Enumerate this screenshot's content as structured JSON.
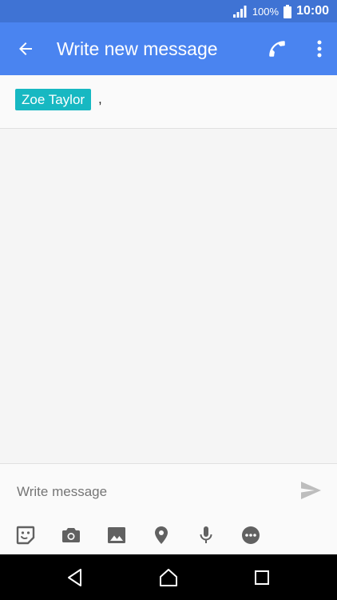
{
  "statusbar": {
    "battery_pct": "100%",
    "time": "10:00",
    "icons": [
      "signal-icon",
      "battery-icon"
    ]
  },
  "appbar": {
    "title": "Write new message",
    "icons": [
      "back-arrow-icon",
      "phone-icon",
      "more-vert-icon"
    ]
  },
  "recipients": [
    {
      "name": "Zoe Taylor"
    }
  ],
  "recipient_separator": ",",
  "compose": {
    "placeholder": "Write message",
    "value": "",
    "send_icon": "send-icon"
  },
  "toolbar": {
    "icons": [
      "sticker-icon",
      "camera-icon",
      "image-icon",
      "location-icon",
      "microphone-icon",
      "more-options-icon"
    ]
  },
  "navbar": {
    "icons": [
      "back-icon",
      "home-icon",
      "recents-icon"
    ]
  },
  "colors": {
    "statusbar": "#3f73d4",
    "appbar": "#4a84f0",
    "chip": "#17b8c2",
    "icon_gray": "#616161",
    "send_gray": "#bdbdbd"
  }
}
